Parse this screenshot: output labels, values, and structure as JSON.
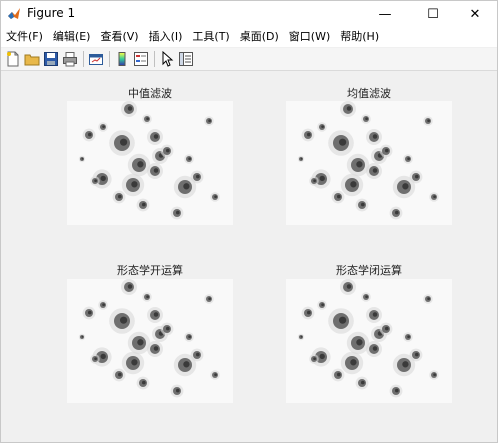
{
  "window": {
    "title": "Figure 1"
  },
  "menu": {
    "items": [
      "文件(F)",
      "编辑(E)",
      "查看(V)",
      "插入(I)",
      "工具(T)",
      "桌面(D)",
      "窗口(W)",
      "帮助(H)"
    ]
  },
  "toolbar": {
    "icons": [
      "new-figure-icon",
      "open-file-icon",
      "save-icon",
      "print-icon",
      "link-plot-icon",
      "insert-colorbar-icon",
      "insert-legend-icon",
      "edit-plot-icon",
      "property-inspector-icon"
    ]
  },
  "axes": {
    "top_left_title": "中值滤波",
    "top_right_title": "均值滤波",
    "bottom_left_title": "形态学开运算",
    "bottom_right_title": "形态学闭运算"
  },
  "colors": {
    "title_bar": "#ffffff",
    "background": "#f0f0f0",
    "cell": "#6f6f6f"
  }
}
